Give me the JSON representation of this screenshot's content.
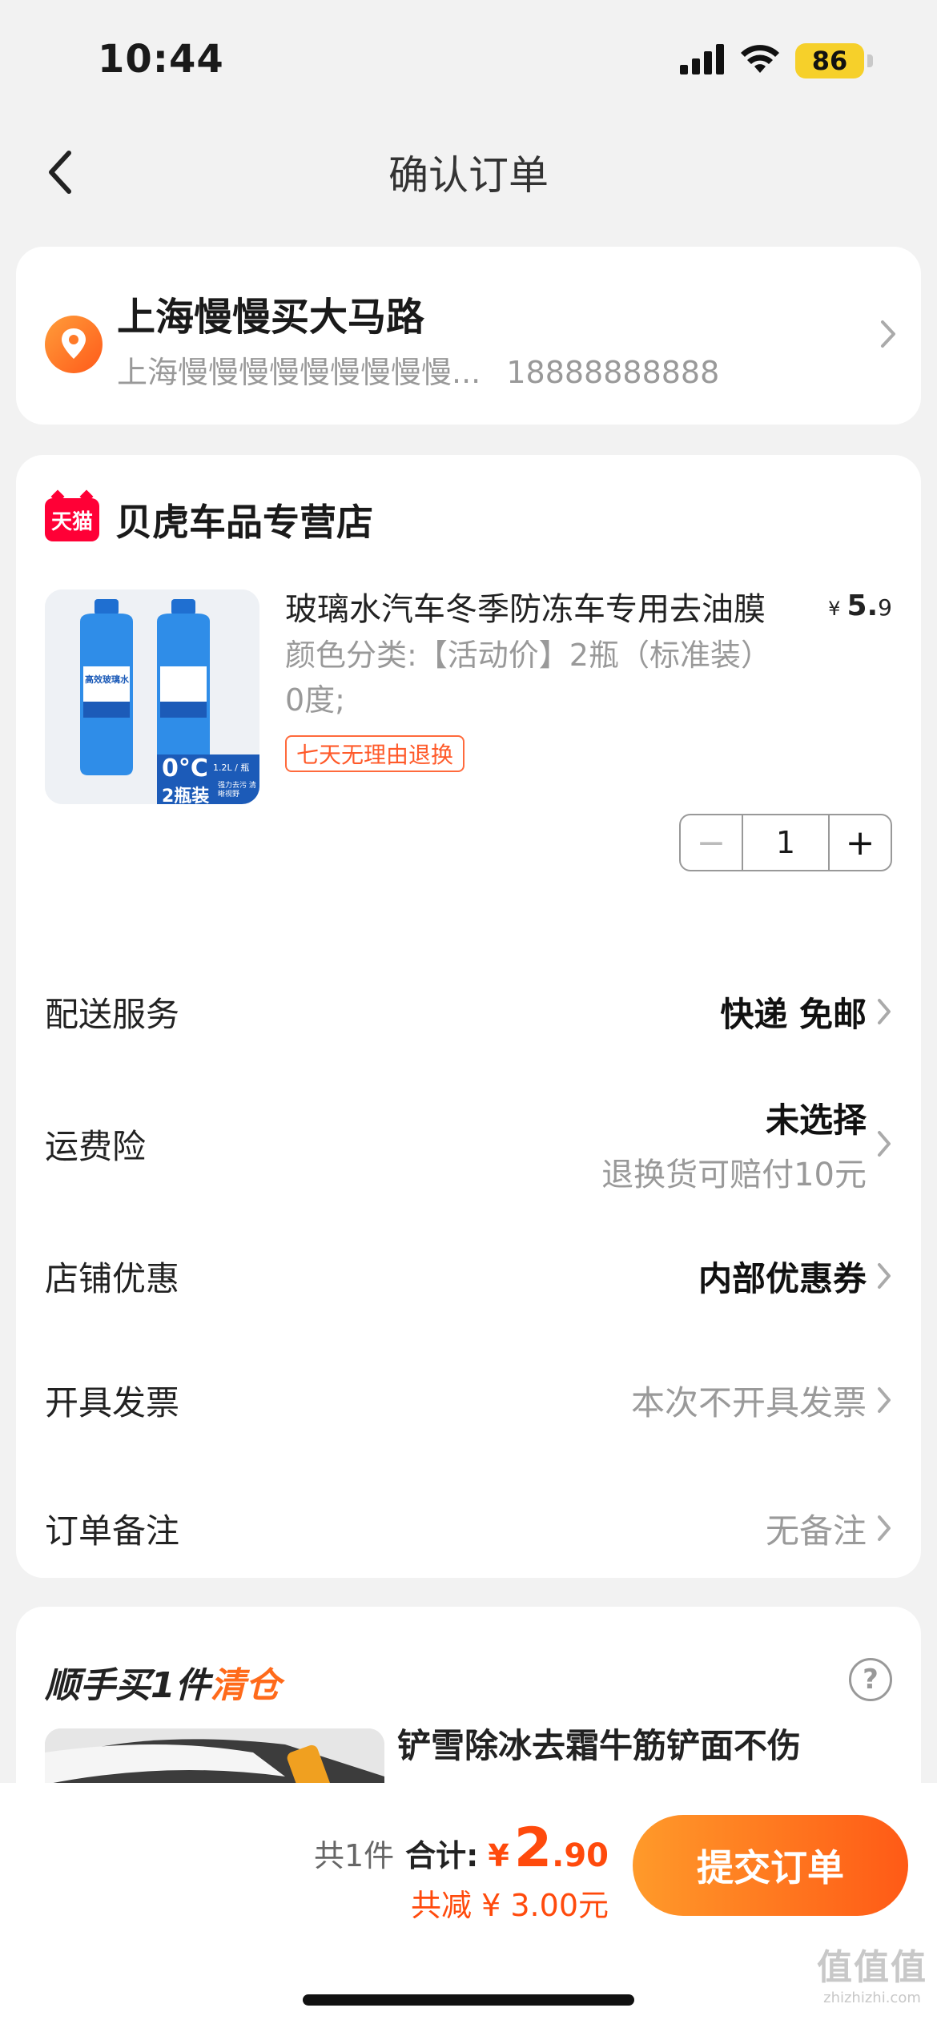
{
  "status": {
    "time": "10:44",
    "battery": "86"
  },
  "nav": {
    "title": "确认订单"
  },
  "address": {
    "title": "上海慢慢买大马路",
    "detail": "上海慢慢慢慢慢慢慢慢慢...",
    "phone": "18888888888"
  },
  "shop": {
    "badge": "天猫",
    "name": "贝虎车品专营店"
  },
  "product": {
    "title": "玻璃水汽车冬季防冻车专用去油膜",
    "price_currency": "¥",
    "price_int": "5.",
    "price_dec": "9",
    "spec": "颜色分类:【活动价】2瓶（标准装）0度;",
    "return_tag": "七天无理由退换",
    "image_labels": {
      "brand": "高效玻璃水",
      "temp": "0°C",
      "volume": "1.2L / 瓶",
      "pack": "2瓶装",
      "note": "强力去污 清晰视野"
    }
  },
  "quantity": {
    "minus": "−",
    "value": "1",
    "plus": "+"
  },
  "rows": {
    "delivery": {
      "label": "配送服务",
      "value": "快递 免邮"
    },
    "insurance": {
      "label": "运费险",
      "value": "未选择",
      "sub": "退换货可赔付10元"
    },
    "discount": {
      "label": "店铺优惠",
      "value": "内部优惠券"
    },
    "invoice": {
      "label": "开具发票",
      "value": "本次不开具发票"
    },
    "note": {
      "label": "订单备注",
      "value": "无备注"
    }
  },
  "extra": {
    "title_main": "顺手买1件",
    "title_accent": "清仓",
    "help": "?",
    "product_title": "铲雪除冰去霜牛筋铲面不伤"
  },
  "summary": {
    "count": "共1件",
    "label": "合计:",
    "currency": "¥",
    "total_int": "2",
    "total_dec": ".90",
    "saved": "共减 ¥ 3.00元",
    "submit": "提交订单"
  },
  "watermark": {
    "logo": "值值值",
    "url": "zhizhizhi.com"
  },
  "colors": {
    "accent": "#ff4a0c",
    "tmall": "#ff0036",
    "submit_from": "#ff9a2a",
    "submit_to": "#ff5a16"
  }
}
